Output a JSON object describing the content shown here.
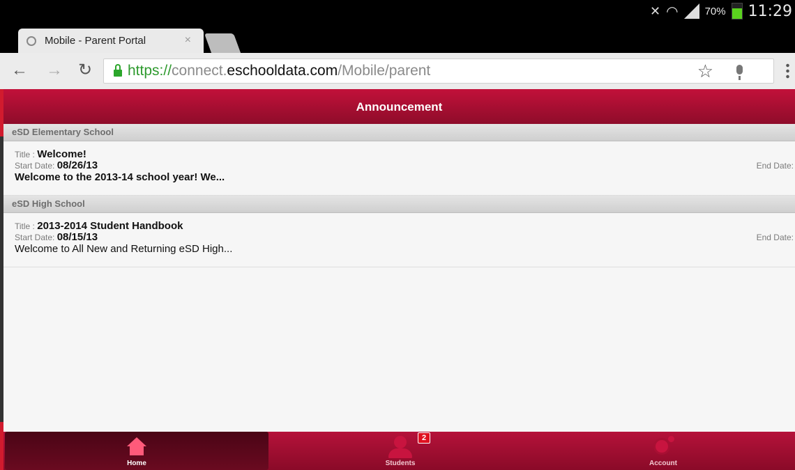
{
  "status_bar": {
    "battery_percent": "70%",
    "battery_level": 0.7,
    "time": "11:29"
  },
  "browser": {
    "tab_title": "Mobile - Parent Portal",
    "tab_close": "×",
    "url_scheme": "https://",
    "url_sub": "connect.",
    "url_domain": "eschooldata.com",
    "url_path": "/Mobile/parent"
  },
  "header": {
    "title": "Announcement"
  },
  "sections": [
    {
      "name": "eSD Elementary School",
      "item": {
        "title_label": "Title : ",
        "title": "Welcome!",
        "start_label": "Start Date: ",
        "start_date": "08/26/13",
        "end_label": "End Date:",
        "description": "Welcome to the 2013-14 school year!  We..."
      }
    },
    {
      "name": "eSD High School",
      "item": {
        "title_label": "Title : ",
        "title": "2013-2014 Student Handbook",
        "start_label": "Start Date: ",
        "start_date": "08/15/13",
        "end_label": "End Date:",
        "description": "Welcome to All New and Returning eSD High..."
      }
    }
  ],
  "footer": {
    "home": "Home",
    "students": "Students",
    "students_badge": "2",
    "account": "Account"
  },
  "colors": {
    "brand": "#b5123a",
    "header_dark": "#8e0c2a",
    "url_green": "#2e9a2e"
  }
}
